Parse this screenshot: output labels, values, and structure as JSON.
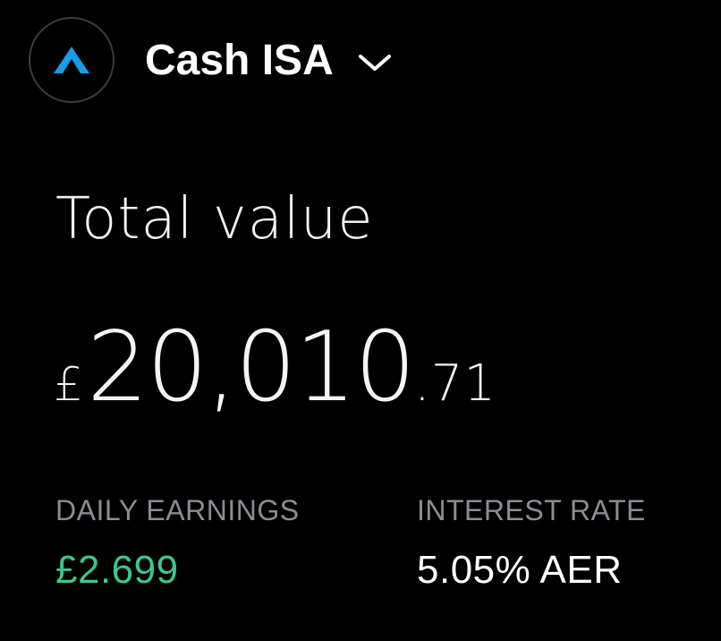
{
  "header": {
    "account_title": "Cash ISA",
    "logo_icon": "caret-up-logo-icon",
    "dropdown_icon": "chevron-down-icon",
    "colors": {
      "logo_accent": "#1a9be8",
      "logo_border": "#3a3d42"
    }
  },
  "summary": {
    "total_label": "Total value",
    "currency_symbol": "£",
    "whole": "20,010",
    "fraction": ".71"
  },
  "stats": {
    "daily_earnings_label": "DAILY EARNINGS",
    "daily_earnings_value": "£2.699",
    "interest_rate_label": "INTEREST RATE",
    "interest_rate_value": "5.05% AER",
    "colors": {
      "positive": "#3cc88a",
      "label": "#8a8d93"
    }
  }
}
